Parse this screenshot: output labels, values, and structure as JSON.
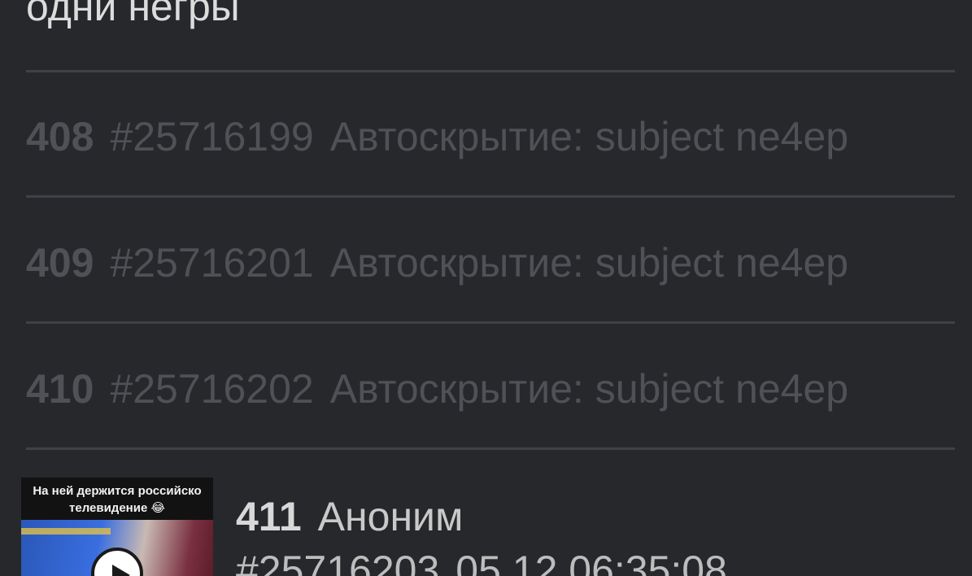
{
  "previous_post": {
    "text": "одни негры"
  },
  "hidden_posts": [
    {
      "number": "408",
      "id": "#25716199",
      "reason": "Автоскрытие: subject ne4ep"
    },
    {
      "number": "409",
      "id": "#25716201",
      "reason": "Автоскрытие: subject ne4ep"
    },
    {
      "number": "410",
      "id": "#25716202",
      "reason": "Автоскрытие: subject ne4ep"
    }
  ],
  "post": {
    "number": "411",
    "author": "Аноним",
    "id": "#25716203",
    "date": "05.12 06:35:08",
    "thumbnail": {
      "caption_line1": "На ней держится российско",
      "caption_line2": "телевидение 😂",
      "icon": "play-icon"
    }
  },
  "colors": {
    "background": "#27282c",
    "divider": "#3f4146",
    "hidden_text": "#4f5156",
    "primary_text": "#d8d8d8"
  }
}
